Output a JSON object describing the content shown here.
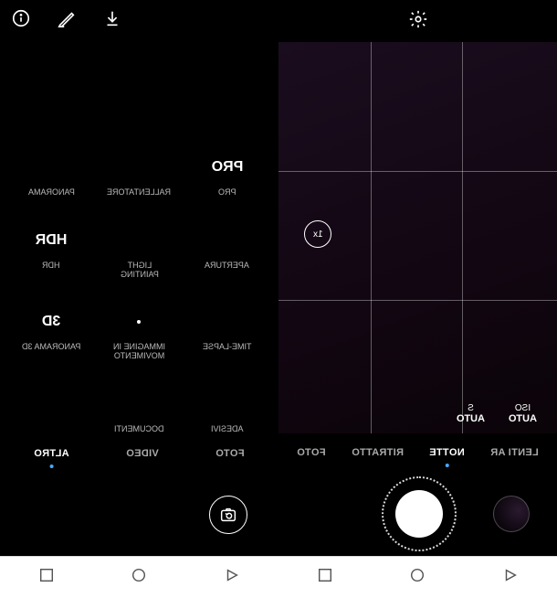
{
  "left": {
    "topbar_icons": [
      "info-icon",
      "pencil-icon",
      "download-icon"
    ],
    "modes": [
      {
        "title": "PANORAMA",
        "sub": "PANORAMA",
        "icon": "panorama"
      },
      {
        "title": "RALLENTATORE",
        "sub": "RALLENTATORE",
        "icon": "slowmo"
      },
      {
        "title": "PRO",
        "sub": "PRO",
        "icon": "text-pro"
      },
      {
        "title": "HDR",
        "sub": "HDR",
        "icon": "text-hdr"
      },
      {
        "title": "LIGHT PAINTING",
        "sub": "LIGHT\nPAINTING",
        "icon": "lightpaint"
      },
      {
        "title": "APERTURA",
        "sub": "APERTURA",
        "icon": "aperture"
      },
      {
        "title": "PANORAMA 3D",
        "sub": "PANORAMA 3D",
        "icon": "text-3d"
      },
      {
        "title": "IMMAGINE IN MOVIMENTO",
        "sub": "IMMAGINE IN\nMOVIMENTO",
        "icon": "liveimage"
      },
      {
        "title": "TIME-LAPSE",
        "sub": "TIME-LAPSE",
        "icon": "timelapse"
      },
      {
        "title": "",
        "sub": "",
        "icon": ""
      },
      {
        "title": "DOCUMENTI",
        "sub": "DOCUMENTI",
        "icon": "document"
      },
      {
        "title": "ADESIVI",
        "sub": "ADESIVI",
        "icon": "stamp"
      }
    ],
    "mode_tabs": [
      {
        "label": "ALTRO",
        "active": true
      },
      {
        "label": "VIDEO",
        "active": false
      },
      {
        "label": "FOTO",
        "active": false
      }
    ]
  },
  "right": {
    "topbar_icons": [
      "gear-icon"
    ],
    "zoom_label": "1x",
    "readouts": [
      {
        "key": "ISO",
        "val": "AUTO"
      },
      {
        "key": "S",
        "val": "AUTO"
      }
    ],
    "mode_tabs": [
      {
        "label": "FOTO",
        "active": false
      },
      {
        "label": "RITRATTO",
        "active": false
      },
      {
        "label": "NOTTE",
        "active": true
      },
      {
        "label": "LENTI AR",
        "active": false
      }
    ]
  }
}
